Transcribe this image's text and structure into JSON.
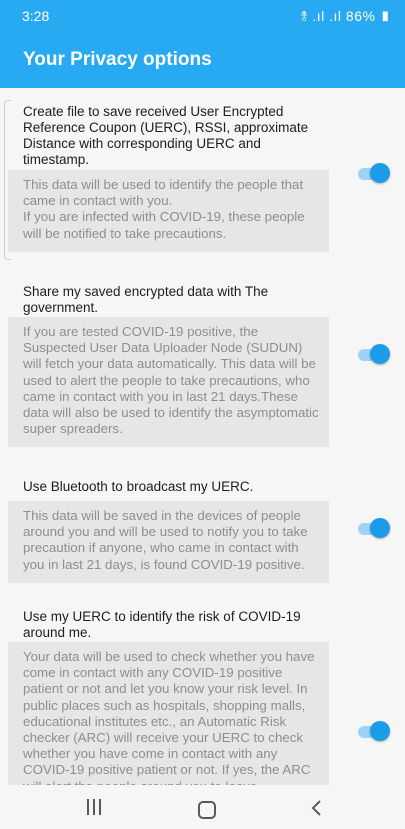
{
  "status": {
    "time": "3:28",
    "icons_text": "≑.ııl .ıl 86%",
    "battery": "86%"
  },
  "appbar": {
    "title": "Your Privacy options"
  },
  "options": [
    {
      "title": "Create file to save received User Encrypted Reference Coupon (UERC), RSSI, approximate Distance with corresponding UERC and timestamp.",
      "description": "This data will be used to identify the people that came in contact with you.\nIf you are infected with COVID-19, these people will be notified to take precautions.",
      "enabled": true
    },
    {
      "title": "Share my saved encrypted data with The government.",
      "description": "If you are tested COVID-19 positive, the Suspected User Data Uploader Node (SUDUN) will fetch your data automatically. This data will be used to alert the people to take precautions, who came in contact with you in last 21 days.These data will also be used to identify the asymptomatic super spreaders.",
      "enabled": true
    },
    {
      "title": "Use Bluetooth to broadcast my UERC.",
      "description": "This data will be saved in the devices of people around you and will be used to notify you to take precaution if anyone, who came in contact with you in last 21 days, is found COVID-19 positive.",
      "enabled": true
    },
    {
      "title": "Use my UERC to identify the risk of COVID-19 around me.",
      "description": "Your data will be used to check whether you have come in contact with any COVID-19 positive patient or not and let you know your risk level. In public places such as hospitals, shopping malls, educational institutes etc., an Automatic Risk checker (ARC) will receive your UERC to check whether you have come in contact with any COVID-19 positive patient or not. If yes, the ARC will alert the people around you to leave",
      "enabled": true
    }
  ],
  "colors": {
    "accent": "#27aaf2",
    "toggle_on": "#1a9ce8",
    "desc_bg": "#e6e6e6"
  }
}
